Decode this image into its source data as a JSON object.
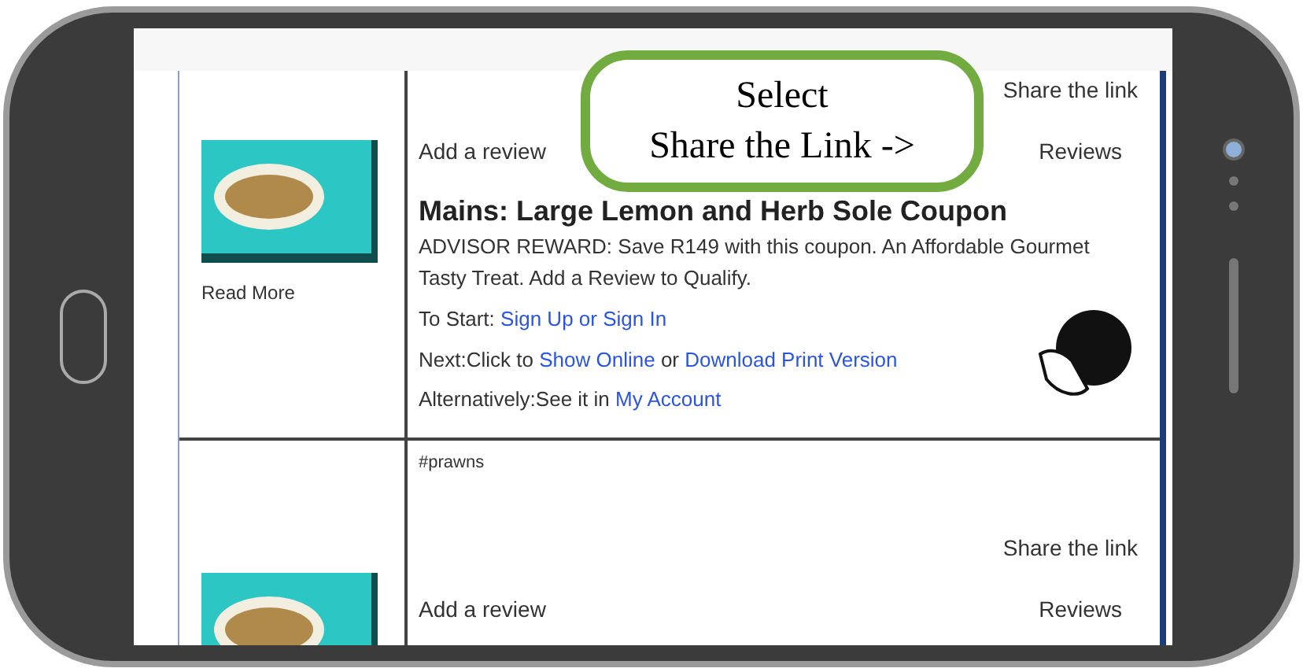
{
  "callout": {
    "lines": [
      "Select",
      "Share the Link ->"
    ]
  },
  "listings": [
    {
      "share": "Share the link",
      "add_review": "Add a review",
      "reviews": "Reviews",
      "read_more": "Read More",
      "title": "Mains: Large Lemon and Herb Sole Coupon",
      "description": "ADVISOR REWARD: Save R149 with this coupon. An Affordable Gourmet Tasty Treat. Add a Review to Qualify.",
      "start": {
        "label": "To Start:",
        "link": "Sign Up or Sign In"
      },
      "next": {
        "label": "Next:Click to",
        "link": "Show Online",
        "or": "or",
        "link2": "Download Print Version"
      },
      "alternative": {
        "label": "Alternatively:See it in",
        "link": "My Account"
      }
    },
    {
      "tag": "#prawns",
      "share": "Share the link",
      "add_review": "Add a review",
      "reviews": "Reviews"
    }
  ]
}
